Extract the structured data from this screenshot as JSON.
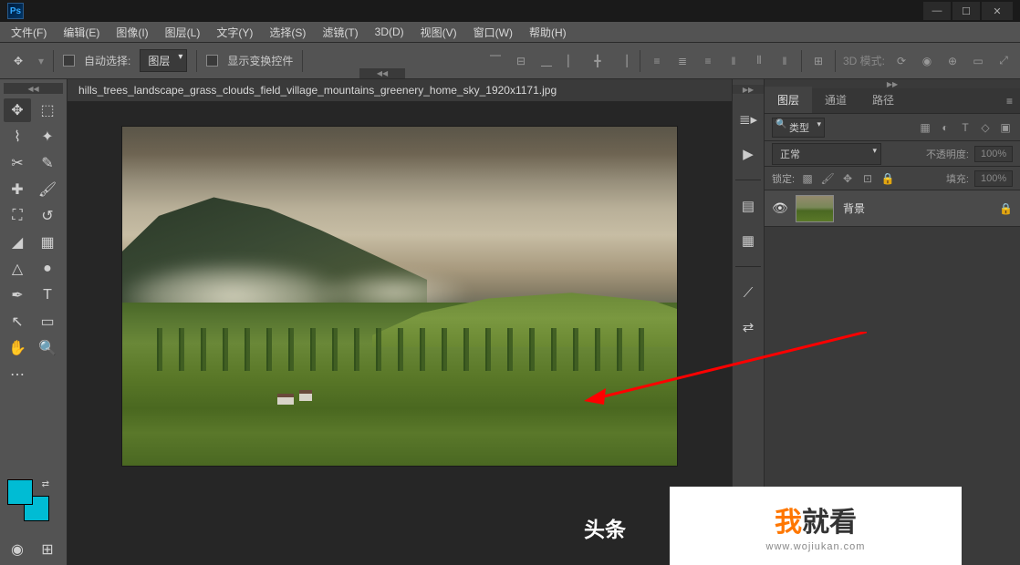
{
  "menubar": {
    "file": "文件(F)",
    "edit": "编辑(E)",
    "image": "图像(I)",
    "layer": "图层(L)",
    "type": "文字(Y)",
    "select": "选择(S)",
    "filter": "滤镜(T)",
    "threed": "3D(D)",
    "view": "视图(V)",
    "window": "窗口(W)",
    "help": "帮助(H)"
  },
  "options": {
    "auto_select_label": "自动选择:",
    "auto_select_target": "图层",
    "show_transform_label": "显示变换控件",
    "mode3d_label": "3D 模式:"
  },
  "document": {
    "tab_title": "hills_trees_landscape_grass_clouds_field_village_mountains_greenery_home_sky_1920x1171.jpg"
  },
  "panels": {
    "tabs": {
      "layers": "图层",
      "channels": "通道",
      "paths": "路径"
    },
    "filter_kind": "类型",
    "blend_mode": "正常",
    "opacity_label": "不透明度:",
    "opacity_value": "100%",
    "lock_label": "锁定:",
    "fill_label": "填充:",
    "fill_value": "100%",
    "layers": [
      {
        "name": "背景",
        "locked": true,
        "visible": true
      }
    ]
  },
  "watermark": {
    "wo": "我",
    "rest": "就看",
    "url": "www.wojiukan.com"
  },
  "toutiao": "头条"
}
